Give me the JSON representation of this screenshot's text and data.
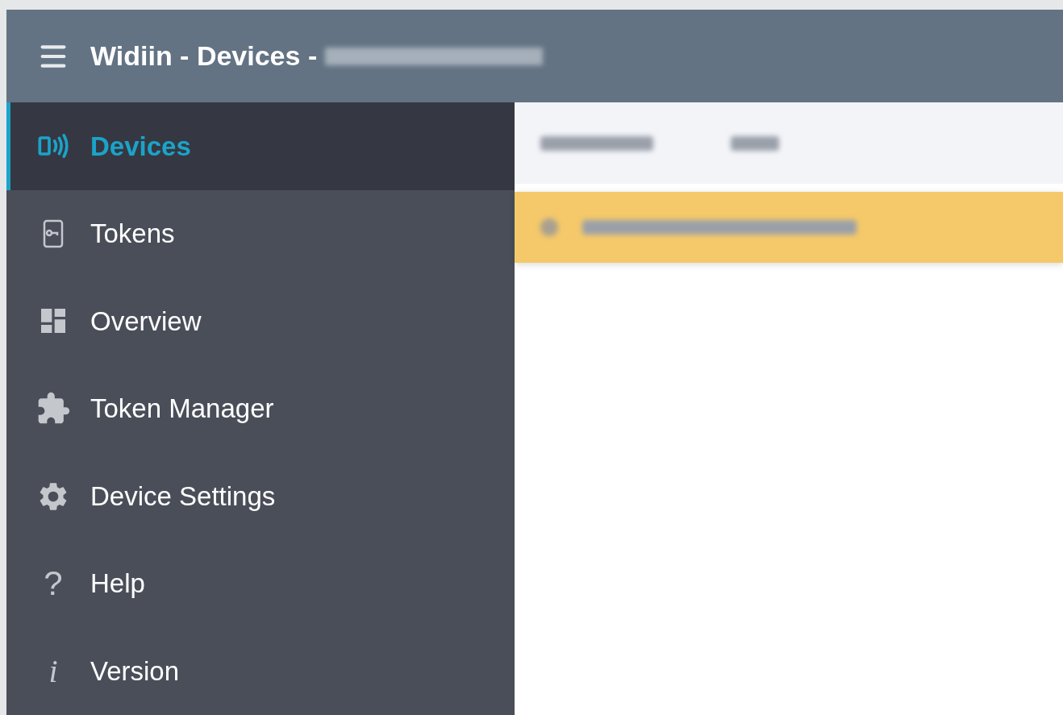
{
  "app_bar": {
    "title": "Widiin - Devices -"
  },
  "nav": [
    {
      "label": "Devices",
      "kind": "devices",
      "selected": true
    },
    {
      "label": "Tokens",
      "kind": "tokens",
      "selected": false
    },
    {
      "label": "Overview",
      "kind": "overview",
      "selected": false
    },
    {
      "label": "Token Manager",
      "kind": "puzzle",
      "selected": false
    },
    {
      "label": "Device Settings",
      "kind": "gear",
      "selected": false
    },
    {
      "label": "Help",
      "kind": "glyph",
      "glyph": "?",
      "selected": false
    },
    {
      "label": "Version",
      "kind": "glyph_italic",
      "glyph": "i",
      "selected": false
    }
  ],
  "table": {
    "rows": [
      {
        "selected": true
      }
    ]
  }
}
